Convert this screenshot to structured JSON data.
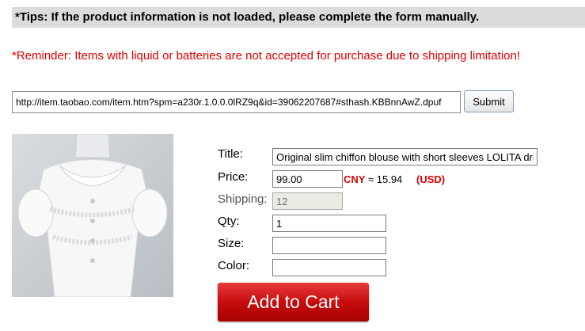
{
  "tips": "*Tips: If the product information is not loaded, please complete the form manually.",
  "reminder": "*Reminder: Items with liquid or batteries are not accepted for purchase due to shipping limitation!",
  "url_form": {
    "url_value": "http://item.taobao.com/item.htm?spm=a230r.1.0.0.0lRZ9q&id=39062207687#sthash.KBBnnAwZ.dpuf",
    "submit_label": "Submit"
  },
  "product": {
    "image_icon": "blouse-product-photo",
    "title_label": "Title:",
    "title_value": "Original slim chiffon blouse with short sleeves LOLITA dress",
    "price_label": "Price:",
    "price_value": "99.00",
    "cny_label": "CNY",
    "approx_text": "≈ 15.94",
    "usd_label": "(USD)",
    "shipping_label": "Shipping:",
    "shipping_value": "12",
    "qty_label": "Qty:",
    "qty_value": "1",
    "size_label": "Size:",
    "size_value": "",
    "color_label": "Color:",
    "color_value": "",
    "add_to_cart_label": "Add to Cart"
  }
}
